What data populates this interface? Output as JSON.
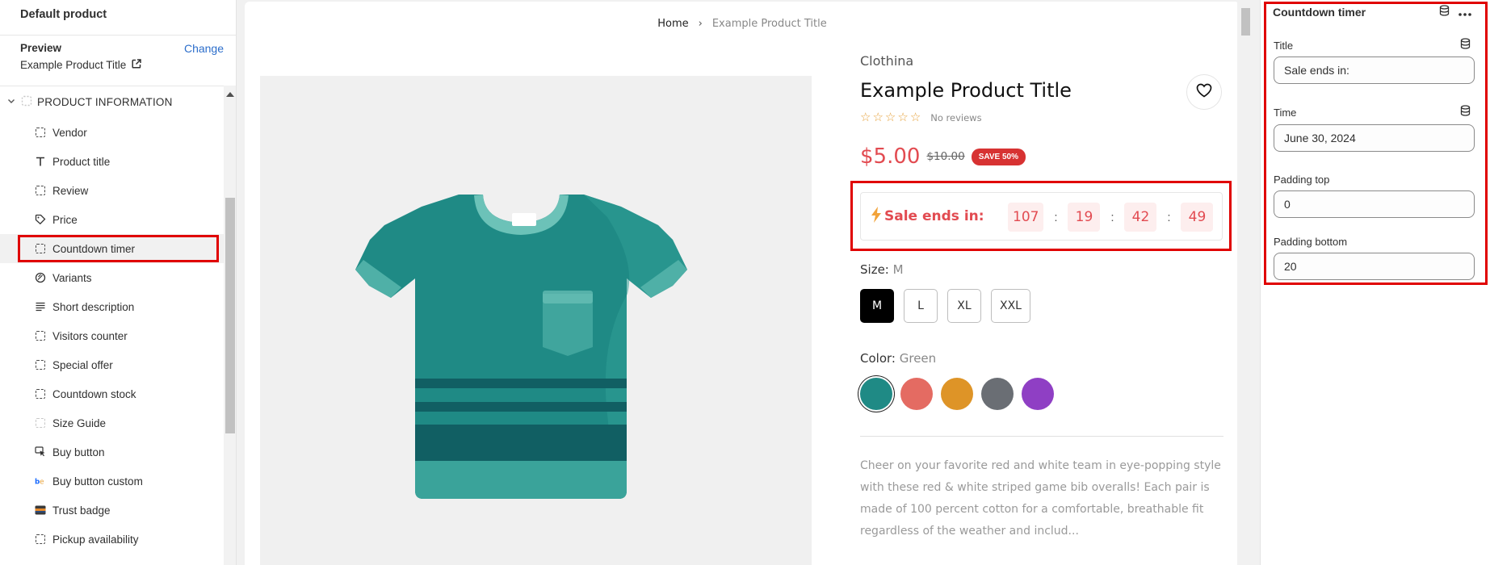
{
  "sidebar": {
    "title": "Default product",
    "preview_label": "Preview",
    "change_label": "Change",
    "preview_value": "Example Product Title",
    "section_label": "PRODUCT INFORMATION",
    "items": [
      {
        "label": "Vendor",
        "icon": "dashed-square-icon"
      },
      {
        "label": "Product title",
        "icon": "text-t-icon"
      },
      {
        "label": "Review",
        "icon": "dashed-square-icon"
      },
      {
        "label": "Price",
        "icon": "price-tag-icon"
      },
      {
        "label": "Countdown timer",
        "icon": "dashed-square-icon",
        "selected": true
      },
      {
        "label": "Variants",
        "icon": "variants-icon"
      },
      {
        "label": "Short description",
        "icon": "text-lines-icon"
      },
      {
        "label": "Visitors counter",
        "icon": "dashed-square-icon"
      },
      {
        "label": "Special offer",
        "icon": "dashed-square-icon"
      },
      {
        "label": "Countdown stock",
        "icon": "dashed-square-icon"
      },
      {
        "label": "Size Guide",
        "icon": "faded-square-icon"
      },
      {
        "label": "Buy button",
        "icon": "cursor-click-icon"
      },
      {
        "label": "Buy button custom",
        "icon": "be-icon"
      },
      {
        "label": "Trust badge",
        "icon": "trust-badge-icon"
      },
      {
        "label": "Pickup availability",
        "icon": "dashed-square-icon"
      }
    ]
  },
  "canvas": {
    "breadcrumb": {
      "home": "Home",
      "separator": "›",
      "current": "Example Product Title"
    },
    "vendor": "Clothina",
    "title": "Example Product Title",
    "reviews_text": "No reviews",
    "price": "$5.00",
    "compare_price": "$10.00",
    "save_badge": "SAVE 50%",
    "countdown": {
      "label": "Sale ends in:",
      "days": "107",
      "hours": "19",
      "minutes": "42",
      "seconds": "49",
      "separator": ":"
    },
    "size": {
      "label": "Size:",
      "value": "M",
      "options": [
        "M",
        "L",
        "XL",
        "XXL"
      ]
    },
    "color": {
      "label": "Color:",
      "value": "Green",
      "swatches": [
        "#1f8a85",
        "#e46b62",
        "#de9427",
        "#6a6e74",
        "#8f3fc4"
      ]
    },
    "description": "Cheer on your favorite red and white team in eye-popping style with these red & white striped game bib overalls! Each pair is made of 100 percent cotton for a comfortable, breathable fit regardless of the weather and includ..."
  },
  "settings_panel": {
    "title": "Countdown timer",
    "fields": {
      "title": {
        "label": "Title",
        "value": "Sale ends in:"
      },
      "time": {
        "label": "Time",
        "value": "June 30, 2024"
      },
      "padding_top": {
        "label": "Padding top",
        "value": "0"
      },
      "padding_bottom": {
        "label": "Padding bottom",
        "value": "20"
      }
    }
  },
  "colors": {
    "accent_red": "#e24b51",
    "highlight_red": "#e00000",
    "link_blue": "#2c6ecb",
    "tshirt_teal": "#1f8a85"
  }
}
